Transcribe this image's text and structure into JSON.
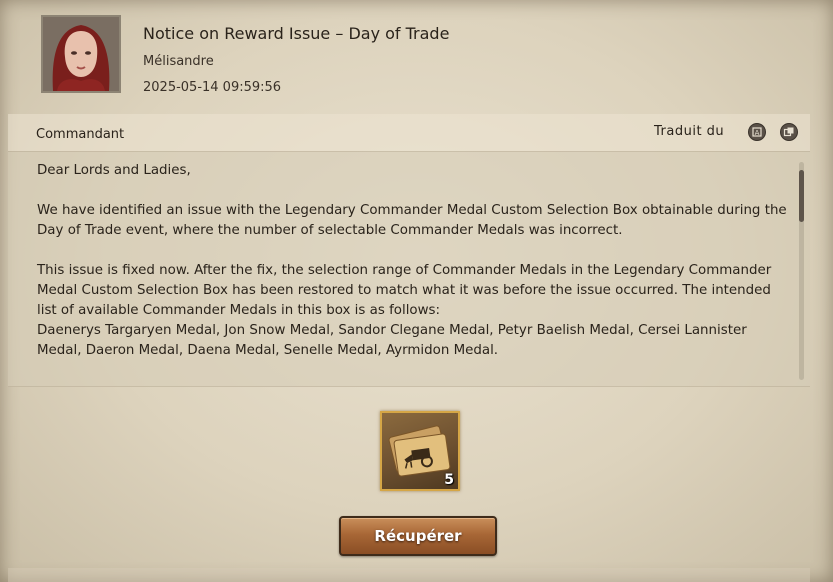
{
  "mail": {
    "title": "Notice on Reward Issue – Day of Trade",
    "sender": "Mélisandre",
    "date": "2025-05-14 09:59:56"
  },
  "subheader": {
    "recipient": "Commandant",
    "translated_label": "Traduit du"
  },
  "icons": {
    "translate": "translate-icon",
    "copy": "copy-icon"
  },
  "body": {
    "greeting": "Dear Lords and Ladies,",
    "paragraph1": "We have identified an issue with the Legendary Commander Medal Custom Selection Box obtainable during the Day of Trade event, where the number of selectable Commander Medals was incorrect.",
    "paragraph2": "This issue is fixed now. After the fix, the selection range of Commander Medals in the Legendary Commander Medal Custom Selection Box has been restored to match what it was before the issue occurred. The intended list of available Commander Medals in this box is as follows:",
    "paragraph3": "Daenerys Targaryen Medal, Jon Snow Medal, Sandor Clegane Medal, Petyr Baelish Medal, Cersei Lannister Medal, Daeron Medal, Daena Medal, Senelle Medal, Ayrmidon Medal."
  },
  "reward": {
    "icon": "trade-cart-ticket-icon",
    "count": "5"
  },
  "actions": {
    "collect_label": "Récupérer"
  },
  "colors": {
    "parchment": "#e2d9c5",
    "button_brown": "#a86736",
    "reward_border": "#d5a646"
  }
}
